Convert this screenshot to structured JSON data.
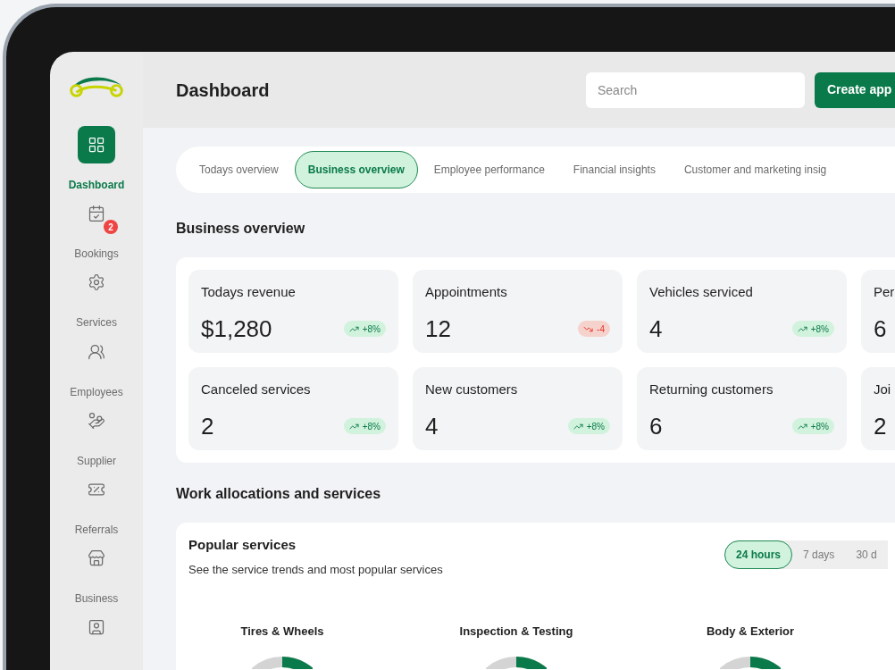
{
  "sidebar": {
    "items": [
      {
        "label": "Dashboard",
        "selected": true
      },
      {
        "label": "Bookings",
        "selected": false,
        "badge": "2"
      },
      {
        "label": "Services",
        "selected": false
      },
      {
        "label": "Employees",
        "selected": false
      },
      {
        "label": "Supplier",
        "selected": false
      },
      {
        "label": "Referrals",
        "selected": false
      },
      {
        "label": "Business",
        "selected": false
      },
      {
        "selected": false
      }
    ]
  },
  "header": {
    "title": "Dashboard",
    "search": {
      "placeholder": "Search"
    },
    "button": "Create app"
  },
  "tabs": [
    {
      "label": "Todays overview",
      "selected": false
    },
    {
      "label": "Business overview",
      "selected": true
    },
    {
      "label": "Employee performance",
      "selected": false
    },
    {
      "label": "Financial insights",
      "selected": false
    },
    {
      "label": "Customer and marketing insig",
      "selected": false
    }
  ],
  "overview": {
    "title": "Business overview",
    "stats": [
      {
        "label": "Todays revenue",
        "value": "$1,280",
        "change": "+8%",
        "kind": "up"
      },
      {
        "label": "Appointments",
        "value": "12",
        "change": "-4",
        "kind": "down"
      },
      {
        "label": "Vehicles serviced",
        "value": "4",
        "change": "+8%",
        "kind": "up"
      },
      {
        "label": "Per",
        "value": "6"
      },
      {
        "label": "Canceled services",
        "value": "2",
        "change": "+8%",
        "kind": "up"
      },
      {
        "label": "New customers",
        "value": "4",
        "change": "+8%",
        "kind": "up"
      },
      {
        "label": "Returning customers",
        "value": "6",
        "change": "+8%",
        "kind": "up"
      },
      {
        "label": "Joi",
        "value": "2"
      }
    ]
  },
  "work": {
    "title": "Work allocations and services",
    "popular": {
      "title": "Popular services",
      "subtitle": "See the service trends and most popular services",
      "ranges": [
        {
          "label": "24 hours",
          "selected": true
        },
        {
          "label": "7 days",
          "selected": false
        },
        {
          "label": "30 d",
          "selected": false
        }
      ],
      "services": [
        "Tires & Wheels",
        "Inspection & Testing",
        "Body & Exterior"
      ]
    }
  }
}
